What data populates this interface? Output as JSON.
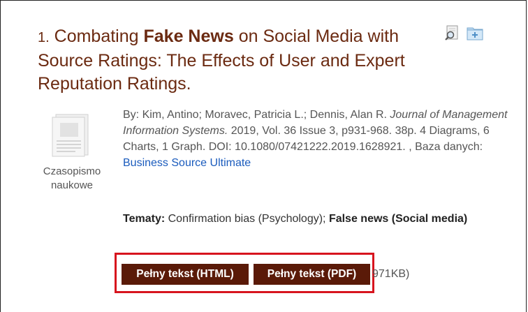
{
  "result": {
    "number": "1.",
    "title_pre": "Combating ",
    "title_bold": "Fake News",
    "title_post": " on Social Media with Source Ratings: The Effects of User and Expert Reputation Ratings.",
    "doc_type": "Czasopismo naukowe",
    "meta": {
      "by_prefix": "By: Kim, Antino; Moravec, Patricia L.; Dennis, Alan R. ",
      "journal": "Journal of Management Information Systems.",
      "details": " 2019, Vol. 36 Issue 3, p931-968. 38p. 4 Diagrams, 6 Charts, 1 Graph. DOI: 10.1080/07421222.2019.1628921. , Baza danych: ",
      "database_link": "Business Source Ultimate"
    },
    "subjects": {
      "label": "Tematy:",
      "plain": " Confirmation bias (Psychology); ",
      "bold": "False news (Social media)"
    },
    "buttons": {
      "html": "Pełny tekst (HTML)",
      "pdf": "Pełny tekst (PDF)",
      "size": "971KB)"
    }
  },
  "icons": {
    "preview": "magnifier-preview-icon",
    "folder": "add-to-folder-icon",
    "document": "journal-document-icon"
  },
  "colors": {
    "title": "#6b2a11",
    "button_bg": "#5a1a08",
    "highlight": "#d7141e",
    "link": "#1a5bbd"
  }
}
